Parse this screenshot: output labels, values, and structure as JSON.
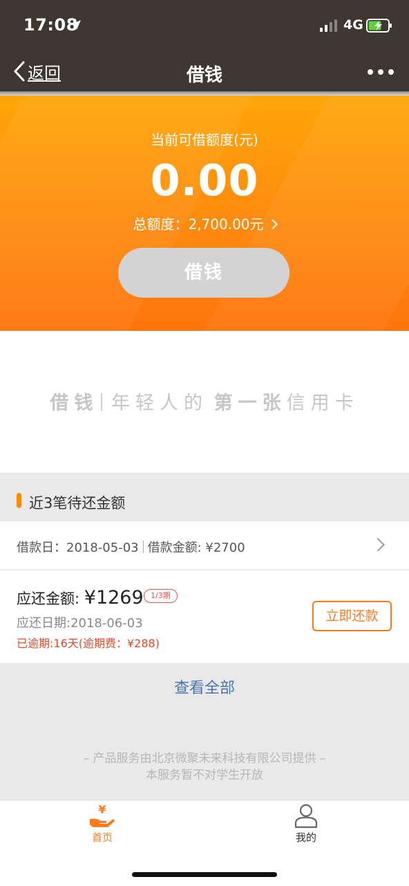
{
  "status_bar": {
    "time": "17:08",
    "network": "4G"
  },
  "nav": {
    "back_label": "返回",
    "title": "借钱"
  },
  "hero": {
    "label": "当前可借额度(元)",
    "amount": "0.00",
    "total_line": "总额度：2,700.00元",
    "button_label": "借钱"
  },
  "slogan": {
    "brand": "借钱",
    "text_a": "年轻人的",
    "text_b": "第一张",
    "text_c": "信用卡"
  },
  "section": {
    "title": "近3笔待还金额"
  },
  "loan": {
    "date_text": "借款日：2018-05-03",
    "amount_text": "借款金额: ¥2700",
    "due_label": "应还金额: ",
    "due_amount": "¥1269",
    "period_badge": "1/3期",
    "due_date": "应还日期:2018-06-03",
    "overdue": "已逾期:16天(逾期费：¥288)",
    "repay_button": "立即还款"
  },
  "view_all": "查看全部",
  "footer": {
    "line1": "– 产品服务由北京微聚未来科技有限公司提供 –",
    "line2": "本服务暂不对学生开放"
  },
  "tabs": [
    {
      "label": "首页",
      "icon": "yen-hand-icon",
      "active": true
    },
    {
      "label": "我的",
      "icon": "user-icon",
      "active": false
    }
  ],
  "colors": {
    "accent": "#ff8a0e",
    "active_tab": "#ff7a1a",
    "nav_bg": "#3d3631",
    "link": "#4a74b0"
  }
}
